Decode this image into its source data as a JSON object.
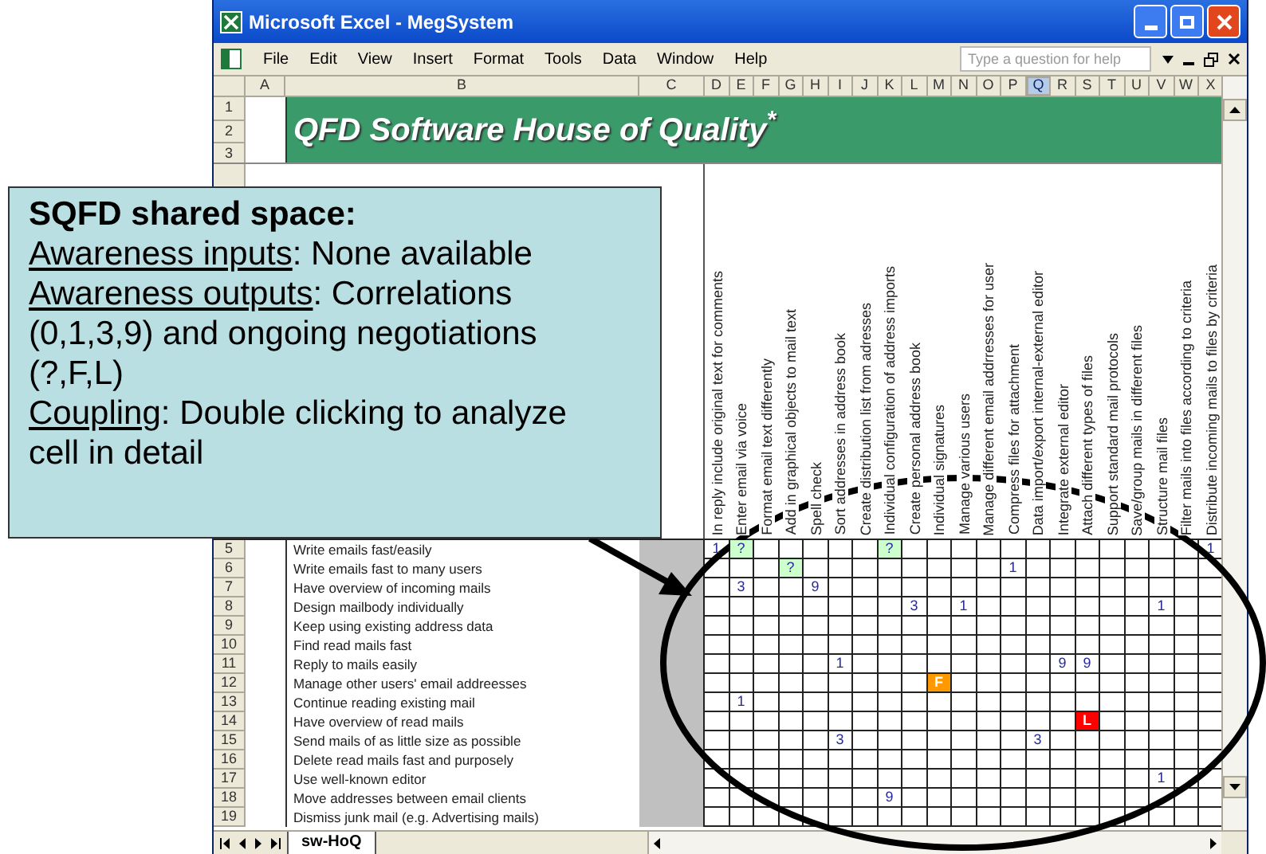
{
  "window": {
    "title": "Microsoft Excel - MegSystem"
  },
  "menu": [
    "File",
    "Edit",
    "View",
    "Insert",
    "Format",
    "Tools",
    "Data",
    "Window",
    "Help"
  ],
  "help_box": {
    "placeholder": "Type a question for help"
  },
  "column_headers": [
    {
      "label": "A",
      "selected": false
    },
    {
      "label": "B",
      "selected": false
    },
    {
      "label": "C",
      "selected": false
    },
    {
      "label": "D",
      "selected": false
    },
    {
      "label": "E",
      "selected": false
    },
    {
      "label": "F",
      "selected": false
    },
    {
      "label": "G",
      "selected": false
    },
    {
      "label": "H",
      "selected": false
    },
    {
      "label": "I",
      "selected": false
    },
    {
      "label": "J",
      "selected": false
    },
    {
      "label": "K",
      "selected": false
    },
    {
      "label": "L",
      "selected": false
    },
    {
      "label": "M",
      "selected": false
    },
    {
      "label": "N",
      "selected": false
    },
    {
      "label": "O",
      "selected": false
    },
    {
      "label": "P",
      "selected": false
    },
    {
      "label": "Q",
      "selected": true
    },
    {
      "label": "R",
      "selected": false
    },
    {
      "label": "S",
      "selected": false
    },
    {
      "label": "T",
      "selected": false
    },
    {
      "label": "U",
      "selected": false
    },
    {
      "label": "V",
      "selected": false
    },
    {
      "label": "W",
      "selected": false
    },
    {
      "label": "X",
      "selected": false
    }
  ],
  "top_row_numbers": [
    "1",
    "2",
    "3"
  ],
  "banner": {
    "title": "QFD Software House of Quality$^{*}$"
  },
  "matrix_columns": [
    {
      "label": "In reply include original text for comments"
    },
    {
      "label": "Enter email via voice"
    },
    {
      "label": "Format email text differently"
    },
    {
      "label": "Add in graphical objects to mail text"
    },
    {
      "label": "Spell check"
    },
    {
      "label": "Sort addresses in address book"
    },
    {
      "label": "Create distribution list from adresses"
    },
    {
      "label": "Individual configuration of address imports"
    },
    {
      "label": "Create personal address book"
    },
    {
      "label": "Individual signatures"
    },
    {
      "label": "Manage various users"
    },
    {
      "label": "Manage different email addrresses for user"
    },
    {
      "label": "Compress files for attachment"
    },
    {
      "label": "Data import/export internal-external editor"
    },
    {
      "label": "Integrate external editor"
    },
    {
      "label": "Attach different types of files"
    },
    {
      "label": "Support standard mail protocols"
    },
    {
      "label": "Save/group mails in different files"
    },
    {
      "label": "Structure mail files"
    },
    {
      "label": "Filter mails into files according to criteria"
    },
    {
      "label": "Distribute incoming mails to files by criteria"
    }
  ],
  "rows": [
    {
      "number": "5",
      "requirement": "Write emails fast/easily",
      "cells": [
        {
          "kind": "number",
          "text": "1"
        },
        {
          "kind": "flag",
          "text": "?",
          "color": "#ccffcc"
        },
        null,
        null,
        null,
        null,
        null,
        {
          "kind": "flag",
          "text": "?",
          "color": "#ccffcc"
        },
        null,
        null,
        null,
        null,
        null,
        null,
        null,
        null,
        null,
        null,
        null,
        null,
        {
          "kind": "number",
          "text": "1"
        }
      ]
    },
    {
      "number": "6",
      "requirement": "Write emails fast to many users",
      "cells": [
        null,
        null,
        null,
        {
          "kind": "flag",
          "text": "?",
          "color": "#ccffcc"
        },
        null,
        null,
        null,
        null,
        null,
        null,
        null,
        null,
        {
          "kind": "number",
          "text": "1"
        }
      ]
    },
    {
      "number": "7",
      "requirement": "Have overview of incoming mails",
      "cells": [
        null,
        {
          "kind": "number",
          "text": "3"
        },
        null,
        null,
        {
          "kind": "number",
          "text": "9"
        }
      ]
    },
    {
      "number": "8",
      "requirement": "Design mailbody individually",
      "cells": [
        null,
        null,
        null,
        null,
        null,
        null,
        null,
        null,
        {
          "kind": "number",
          "text": "3"
        },
        null,
        {
          "kind": "number",
          "text": "1"
        },
        null,
        null,
        null,
        null,
        null,
        null,
        null,
        {
          "kind": "number",
          "text": "1"
        }
      ]
    },
    {
      "number": "9",
      "requirement": "Keep using existing address data"
    },
    {
      "number": "10",
      "requirement": "Find read mails fast"
    },
    {
      "number": "11",
      "requirement": "Reply to mails easily",
      "cells": [
        null,
        null,
        null,
        null,
        null,
        {
          "kind": "number",
          "text": "1"
        },
        null,
        null,
        null,
        null,
        null,
        null,
        null,
        null,
        {
          "kind": "number",
          "text": "9"
        },
        {
          "kind": "number",
          "text": "9"
        }
      ]
    },
    {
      "number": "12",
      "requirement": "Manage other users' email addreesses",
      "cells": [
        null,
        null,
        null,
        null,
        null,
        null,
        null,
        null,
        null,
        {
          "kind": "flag",
          "text": "F",
          "color": "#ff9900"
        }
      ]
    },
    {
      "number": "13",
      "requirement": "Continue reading existing mail",
      "cells": [
        null,
        {
          "kind": "number",
          "text": "1"
        }
      ]
    },
    {
      "number": "14",
      "requirement": "Have overview of read mails",
      "cells": [
        null,
        null,
        null,
        null,
        null,
        null,
        null,
        null,
        null,
        null,
        null,
        null,
        null,
        null,
        null,
        {
          "kind": "flag",
          "text": "L",
          "color": "#ff0000"
        }
      ]
    },
    {
      "number": "15",
      "requirement": "Send mails of as little size as possible",
      "cells": [
        null,
        null,
        null,
        null,
        null,
        {
          "kind": "number",
          "text": "3"
        },
        null,
        null,
        null,
        null,
        null,
        null,
        null,
        {
          "kind": "number",
          "text": "3"
        }
      ]
    },
    {
      "number": "16",
      "requirement": "Delete read mails fast and purposely"
    },
    {
      "number": "17",
      "requirement": "Use well-known editor",
      "cells": [
        null,
        null,
        null,
        null,
        null,
        null,
        null,
        null,
        null,
        null,
        null,
        null,
        null,
        null,
        null,
        null,
        null,
        null,
        {
          "kind": "number",
          "text": "1"
        }
      ]
    },
    {
      "number": "18",
      "requirement": "Move addresses between email clients",
      "cells": [
        null,
        null,
        null,
        null,
        null,
        null,
        null,
        {
          "kind": "number",
          "text": "9"
        }
      ]
    },
    {
      "number": "19",
      "requirement": "Dismiss junk mail (e.g. Advertising mails)"
    }
  ],
  "sheet_tabs": [
    {
      "label": "sw-HoQ",
      "selected": true
    }
  ],
  "callout": {
    "heading": "SQFD shared space:",
    "lines": [
      {
        "term": "Awareness inputs",
        "text": ": None available"
      },
      {
        "term": "Awareness outputs",
        "text": ": Correlations (0,1,3,9) and ongoing negotiations (?,F,L)"
      },
      {
        "term": "Coupling",
        "text": ": Double clicking to analyze cell in detail"
      }
    ]
  }
}
